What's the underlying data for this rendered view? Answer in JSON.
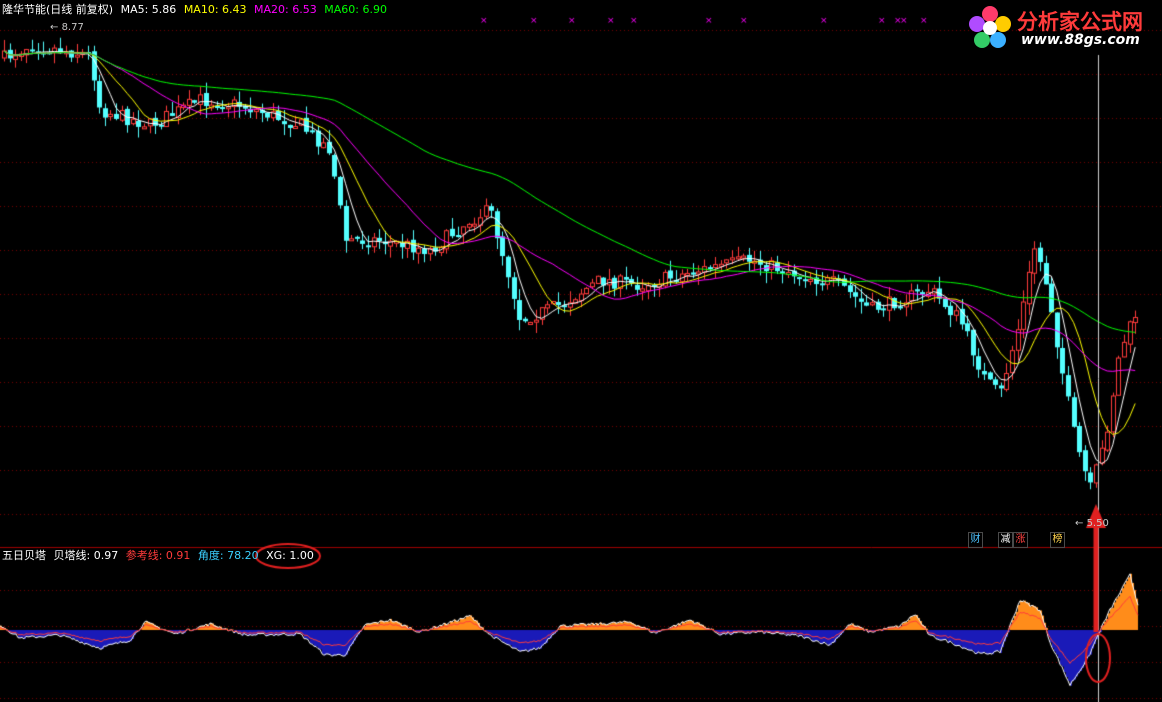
{
  "main_header": {
    "stock_name": "隆华节能(日线 前复权)",
    "ma5": "MA5: 5.86",
    "ma10": "MA10: 6.43",
    "ma20": "MA20: 6.53",
    "ma60": "MA60: 6.90"
  },
  "logo": {
    "title": "分析家公式网",
    "url": "www.88gs.com"
  },
  "high_label": "8.77",
  "low_label": "5.50",
  "badges": [
    {
      "text": "财",
      "color": "#4fc3ff"
    },
    {
      "text": "减",
      "color": "#ffffff"
    },
    {
      "text": "涨",
      "color": "#ff4040"
    },
    {
      "text": "榜",
      "color": "#ffd24d"
    }
  ],
  "sub_header": {
    "name": "五日贝塔",
    "beta": "贝塔线: 0.97",
    "ref": "参考线: 0.91",
    "angle": "角度: 78.20",
    "xg": "XG: 1.00"
  },
  "colors": {
    "up": "#ff3b3b",
    "down": "#54ffff",
    "ma5": "#ffffff",
    "ma10": "#ffff00",
    "ma20": "#ff00ff",
    "ma60": "#00ff00",
    "beta_pos": "#ff8c1a",
    "beta_neg": "#1a1ab8",
    "grid": "#7a0000",
    "annot": "#e02020"
  }
}
